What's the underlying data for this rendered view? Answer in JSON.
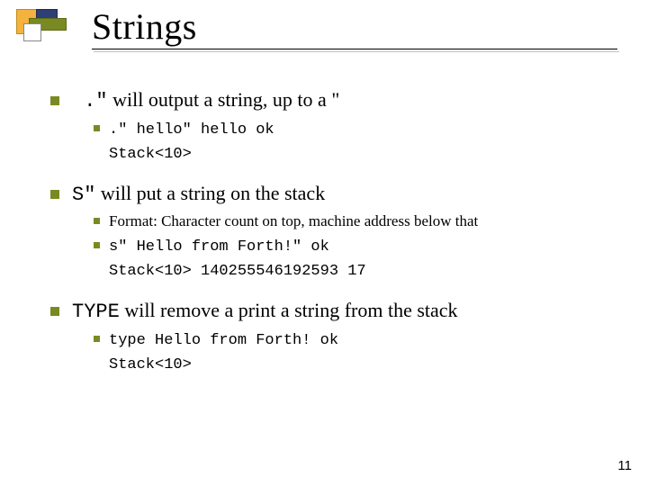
{
  "title": "Strings",
  "items": [
    {
      "label_parts": {
        "code": "  .\"",
        "text": "  will output a string, up to a \""
      },
      "sub": [
        {
          "code_lines": [
            ".\" hello\" hello    ok",
            "Stack<10>"
          ]
        }
      ]
    },
    {
      "label_parts": {
        "code": "S\"",
        "text": "  will put a string on the stack"
      },
      "sub": [
        {
          "text": "Format: Character count on top, machine address below that"
        },
        {
          "code_lines": [
            "s\" Hello from Forth!\"     ok",
            "Stack<10> 140255546192593 17"
          ]
        }
      ]
    },
    {
      "label_parts": {
        "code": "TYPE",
        "text": "  will remove a print a string from the stack"
      },
      "sub": [
        {
          "code_lines": [
            "type Hello from Forth!    ok",
            "Stack<10>"
          ]
        }
      ]
    }
  ],
  "page_number": "11"
}
